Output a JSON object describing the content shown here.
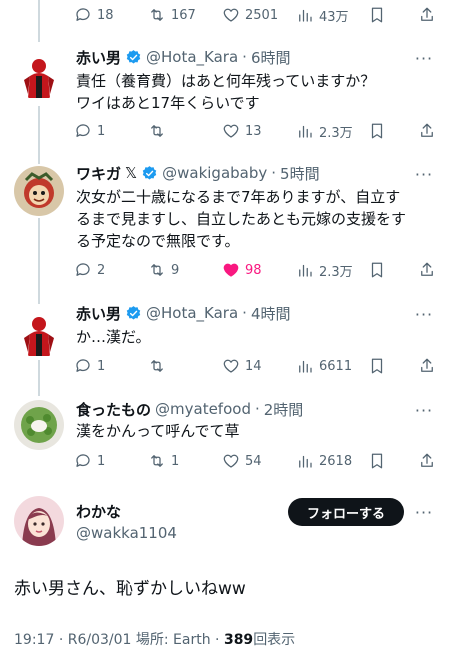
{
  "top_action_bar": {
    "replies": "18",
    "retweets": "167",
    "likes": "2501",
    "views": "43万"
  },
  "replies": [
    {
      "name": "赤い男",
      "verified": true,
      "handle": "@Hota_Kara",
      "time": "6時間",
      "text_lines": [
        "責任（養育費）はあと何年残っていますか？",
        "ワイはあと17年くらいです"
      ],
      "replies": "1",
      "retweets": "",
      "likes": "13",
      "views": "2.3万",
      "liked": false
    },
    {
      "name": "ワキガ",
      "name_suffix": "𝕏",
      "verified": true,
      "handle": "@wakigababy",
      "time": "5時間",
      "text_lines": [
        "次女が二十歳になるまで7年ありますが、自立す",
        "るまで見ますし、自立したあとも元嫁の支援をす",
        "る予定なので無限です。"
      ],
      "replies": "2",
      "retweets": "9",
      "likes": "98",
      "views": "2.3万",
      "liked": true
    },
    {
      "name": "赤い男",
      "verified": true,
      "handle": "@Hota_Kara",
      "time": "4時間",
      "text_lines": [
        "か…漢だ。"
      ],
      "replies": "1",
      "retweets": "",
      "likes": "14",
      "views": "6611",
      "liked": false
    },
    {
      "name": "食ったもの",
      "verified": false,
      "handle": "@myatefood",
      "time": "2時間",
      "text_lines": [
        "漢をかんって呼んでて草"
      ],
      "replies": "1",
      "retweets": "1",
      "likes": "54",
      "views": "2618",
      "liked": false
    }
  ],
  "main_post": {
    "name": "わかな",
    "handle": "@wakka1104",
    "follow_label": "フォローする",
    "text": "赤い男さん、恥ずかしいねww",
    "time": "19:17",
    "date": "R6/03/01",
    "location": "場所: Earth",
    "separator": "·",
    "views": "389",
    "views_label": "回表示"
  },
  "colors": {
    "text": "#0f1419",
    "secondary": "#536471",
    "verified": "#1d9bf0",
    "like": "#f91880",
    "thread_line": "#cfd9de"
  }
}
